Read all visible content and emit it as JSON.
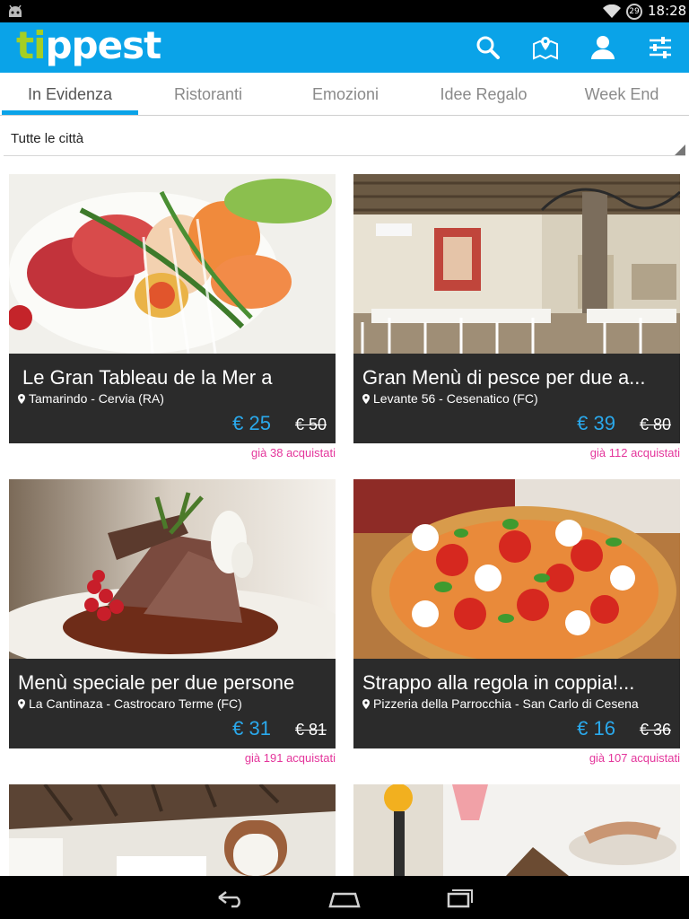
{
  "status": {
    "time": "18:28",
    "battery": "29"
  },
  "app": {
    "logo_ti": "ti",
    "logo_rest": "ppest"
  },
  "tabs": [
    {
      "label": "In Evidenza"
    },
    {
      "label": "Ristoranti"
    },
    {
      "label": "Emozioni"
    },
    {
      "label": "Idee Regalo"
    },
    {
      "label": "Week End"
    }
  ],
  "city_filter": {
    "selected": "Tutte le città"
  },
  "deals": [
    {
      "title": "Le Gran Tableau de la Mer a",
      "place": "Tamarindo - Cervia (RA)",
      "price": "€ 25",
      "old_price": "€ 50",
      "sold": "già 38 acquistati"
    },
    {
      "title": "Gran Menù di pesce per due a...",
      "place": "Levante 56 - Cesenatico (FC)",
      "price": "€ 39",
      "old_price": "€ 80",
      "sold": "già 112 acquistati"
    },
    {
      "title": "Menù speciale per due persone",
      "place": "La Cantinaza - Castrocaro Terme (FC)",
      "price": "€ 31",
      "old_price": "€ 81",
      "sold": "già 191 acquistati"
    },
    {
      "title": "Strappo alla regola in coppia!...",
      "place": "Pizzeria della Parrocchia - San Carlo di Cesena",
      "price": "€ 16",
      "old_price": "€ 36",
      "sold": "già 107 acquistati"
    }
  ],
  "colors": {
    "accent": "#0aa3e8",
    "logo_green": "#a5cf24",
    "sold_pink": "#e4359b",
    "price_blue": "#2aa9ec",
    "card_dark": "#2b2b2b"
  },
  "icons": [
    "android-icon",
    "wifi-icon",
    "battery-icon",
    "search-icon",
    "map-icon",
    "user-icon",
    "settings-sliders-icon",
    "location-pin-icon",
    "back-icon",
    "home-icon",
    "recents-icon"
  ]
}
